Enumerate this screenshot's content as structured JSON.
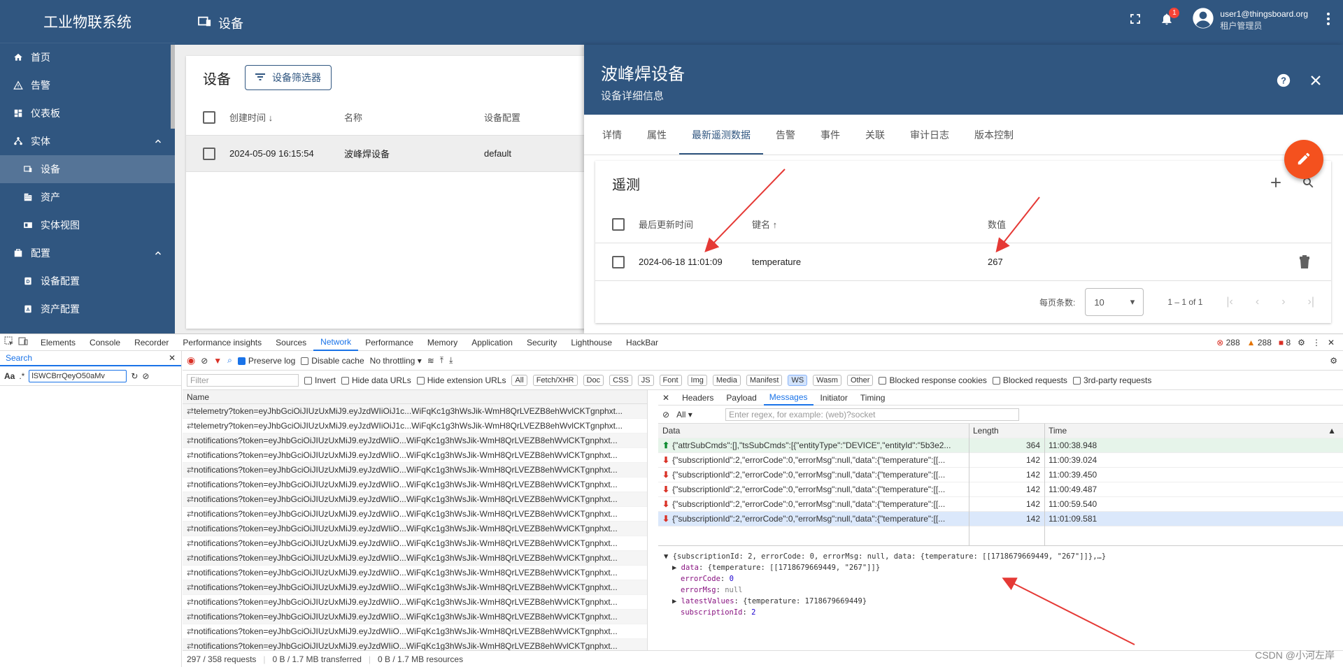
{
  "sidebar": {
    "brand": "工业物联系统",
    "items": [
      {
        "label": "首页",
        "icon": "home-icon"
      },
      {
        "label": "告警",
        "icon": "warning-icon"
      },
      {
        "label": "仪表板",
        "icon": "dashboard-icon"
      },
      {
        "label": "实体",
        "icon": "entity-icon"
      },
      {
        "label": "设备",
        "icon": "device-icon"
      },
      {
        "label": "资产",
        "icon": "asset-icon"
      },
      {
        "label": "实体视图",
        "icon": "entity-view-icon"
      },
      {
        "label": "配置",
        "icon": "config-icon"
      },
      {
        "label": "设备配置",
        "icon": "device-profile-icon"
      },
      {
        "label": "资产配置",
        "icon": "asset-profile-icon"
      }
    ]
  },
  "topbar": {
    "title": "设备",
    "notification_count": "1",
    "user_email": "user1@thingsboard.org",
    "user_role": "租户管理员"
  },
  "devices": {
    "title": "设备",
    "filter_label": "设备筛选器",
    "columns": [
      "创建时间",
      "名称",
      "设备配置"
    ],
    "rows": [
      {
        "created": "2024-05-09 16:15:54",
        "name": "波峰焊设备",
        "profile": "default"
      }
    ]
  },
  "panel": {
    "title": "波峰焊设备",
    "subtitle": "设备详细信息",
    "tabs": [
      "详情",
      "属性",
      "最新遥测数据",
      "告警",
      "事件",
      "关联",
      "审计日志",
      "版本控制"
    ],
    "active_tab": "最新遥测数据",
    "telemetry": {
      "title": "遥测",
      "columns": [
        "最后更新时间",
        "键名",
        "数值"
      ],
      "rows": [
        {
          "time": "2024-06-18 11:01:09",
          "key": "temperature",
          "value": "267"
        }
      ],
      "page_size_label": "每页条数:",
      "page_size": "10",
      "range": "1 – 1 of 1"
    }
  },
  "devtools": {
    "tabs": [
      "Elements",
      "Console",
      "Recorder",
      "Performance insights",
      "Sources",
      "Network",
      "Performance",
      "Memory",
      "Application",
      "Security",
      "Lighthouse",
      "HackBar"
    ],
    "active_tab": "Network",
    "error_count": "288",
    "warning_count": "288",
    "issue_count": "8",
    "search_tab": "Search",
    "search_value": "lSWCBrrQeyO50aMv",
    "preserve_log": "Preserve log",
    "disable_cache": "Disable cache",
    "throttling": "No throttling",
    "filter_placeholder": "Filter",
    "invert": "Invert",
    "hide_data_urls": "Hide data URLs",
    "hide_ext_urls": "Hide extension URLs",
    "type_filters": [
      "All",
      "Fetch/XHR",
      "Doc",
      "CSS",
      "JS",
      "Font",
      "Img",
      "Media",
      "Manifest",
      "WS",
      "Wasm",
      "Other"
    ],
    "blocked_cookies": "Blocked response cookies",
    "blocked_requests": "Blocked requests",
    "third_party": "3rd-party requests",
    "name_header": "Name",
    "requests": [
      "telemetry?token=eyJhbGciOiJIUzUxMiJ9.eyJzdWIiOiJ1c...WiFqKc1g3hWsJik-WmH8QrLVEZB8ehWvlCKTgnphxt...",
      "telemetry?token=eyJhbGciOiJIUzUxMiJ9.eyJzdWIiOiJ1c...WiFqKc1g3hWsJik-WmH8QrLVEZB8ehWvlCKTgnphxt...",
      "notifications?token=eyJhbGciOiJIUzUxMiJ9.eyJzdWIiO...WiFqKc1g3hWsJik-WmH8QrLVEZB8ehWvlCKTgnphxt...",
      "notifications?token=eyJhbGciOiJIUzUxMiJ9.eyJzdWIiO...WiFqKc1g3hWsJik-WmH8QrLVEZB8ehWvlCKTgnphxt...",
      "notifications?token=eyJhbGciOiJIUzUxMiJ9.eyJzdWIiO...WiFqKc1g3hWsJik-WmH8QrLVEZB8ehWvlCKTgnphxt...",
      "notifications?token=eyJhbGciOiJIUzUxMiJ9.eyJzdWIiO...WiFqKc1g3hWsJik-WmH8QrLVEZB8ehWvlCKTgnphxt...",
      "notifications?token=eyJhbGciOiJIUzUxMiJ9.eyJzdWIiO...WiFqKc1g3hWsJik-WmH8QrLVEZB8ehWvlCKTgnphxt...",
      "notifications?token=eyJhbGciOiJIUzUxMiJ9.eyJzdWIiO...WiFqKc1g3hWsJik-WmH8QrLVEZB8ehWvlCKTgnphxt...",
      "notifications?token=eyJhbGciOiJIUzUxMiJ9.eyJzdWIiO...WiFqKc1g3hWsJik-WmH8QrLVEZB8ehWvlCKTgnphxt...",
      "notifications?token=eyJhbGciOiJIUzUxMiJ9.eyJzdWIiO...WiFqKc1g3hWsJik-WmH8QrLVEZB8ehWvlCKTgnphxt...",
      "notifications?token=eyJhbGciOiJIUzUxMiJ9.eyJzdWIiO...WiFqKc1g3hWsJik-WmH8QrLVEZB8ehWvlCKTgnphxt...",
      "notifications?token=eyJhbGciOiJIUzUxMiJ9.eyJzdWIiO...WiFqKc1g3hWsJik-WmH8QrLVEZB8ehWvlCKTgnphxt...",
      "notifications?token=eyJhbGciOiJIUzUxMiJ9.eyJzdWIiO...WiFqKc1g3hWsJik-WmH8QrLVEZB8ehWvlCKTgnphxt...",
      "notifications?token=eyJhbGciOiJIUzUxMiJ9.eyJzdWIiO...WiFqKc1g3hWsJik-WmH8QrLVEZB8ehWvlCKTgnphxt...",
      "notifications?token=eyJhbGciOiJIUzUxMiJ9.eyJzdWIiO...WiFqKc1g3hWsJik-WmH8QrLVEZB8ehWvlCKTgnphxt...",
      "notifications?token=eyJhbGciOiJIUzUxMiJ9.eyJzdWIiO...WiFqKc1g3hWsJik-WmH8QrLVEZB8ehWvlCKTgnphxt...",
      "notifications?token=eyJhbGciOiJIUzUxMiJ9.eyJzdWIiO...WiFqKc1g3hWsJik-WmH8QrLVEZB8ehWvlCKTgnphxt..."
    ],
    "status": {
      "requests": "297 / 358 requests",
      "transferred": "0 B / 1.7 MB transferred",
      "resources": "0 B / 1.7 MB resources"
    },
    "msg_tabs": [
      "Headers",
      "Payload",
      "Messages",
      "Initiator",
      "Timing"
    ],
    "msg_active": "Messages",
    "msg_filter_all": "All",
    "msg_filter_placeholder": "Enter regex, for example: (web)?socket",
    "msg_columns": [
      "Data",
      "Length",
      "Time"
    ],
    "messages": [
      {
        "dir": "up",
        "data": "{\"attrSubCmds\":[],\"tsSubCmds\":[{\"entityType\":\"DEVICE\",\"entityId\":\"5b3e2...",
        "length": "364",
        "time": "11:00:38.948"
      },
      {
        "dir": "down",
        "data": "{\"subscriptionId\":2,\"errorCode\":0,\"errorMsg\":null,\"data\":{\"temperature\":[[...",
        "length": "142",
        "time": "11:00:39.024"
      },
      {
        "dir": "down",
        "data": "{\"subscriptionId\":2,\"errorCode\":0,\"errorMsg\":null,\"data\":{\"temperature\":[[...",
        "length": "142",
        "time": "11:00:39.450"
      },
      {
        "dir": "down",
        "data": "{\"subscriptionId\":2,\"errorCode\":0,\"errorMsg\":null,\"data\":{\"temperature\":[[...",
        "length": "142",
        "time": "11:00:49.487"
      },
      {
        "dir": "down",
        "data": "{\"subscriptionId\":2,\"errorCode\":0,\"errorMsg\":null,\"data\":{\"temperature\":[[...",
        "length": "142",
        "time": "11:00:59.540"
      },
      {
        "dir": "down",
        "data": "{\"subscriptionId\":2,\"errorCode\":0,\"errorMsg\":null,\"data\":{\"temperature\":[[...",
        "length": "142",
        "time": "11:01:09.581"
      }
    ],
    "detail": {
      "summary": "{subscriptionId: 2, errorCode: 0, errorMsg: null, data: {temperature: [[1718679669449, \"267\"]]},…}",
      "data_line": "{temperature: [[1718679669449, \"267\"]]}",
      "errorCode": "0",
      "errorMsg": "null",
      "latestValues": "{temperature: 1718679669449}",
      "subscriptionId": "2"
    }
  },
  "watermark": "CSDN @小河左岸",
  "colors": {
    "primary": "#305680",
    "accent": "#f4511e",
    "annotation": "#e53935"
  }
}
